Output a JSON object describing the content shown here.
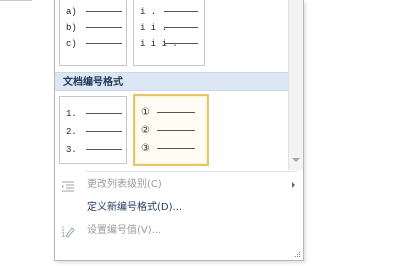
{
  "gallery": {
    "letter_tile": {
      "markers": [
        "a)",
        "b)",
        "c)"
      ]
    },
    "roman_tile": {
      "markers": [
        "i .",
        "i i .",
        "i i i ."
      ]
    },
    "section_title": "文档编号格式",
    "numeric_tile": {
      "markers": [
        "1.",
        "2.",
        "3."
      ]
    },
    "circle_tile": {
      "markers": [
        "①",
        "②",
        "③"
      ],
      "selected": true
    }
  },
  "menu": {
    "change_level": {
      "label": "更改列表级别(C)",
      "enabled": false,
      "has_submenu": true,
      "icon": "indent-level-icon"
    },
    "define_format": {
      "label": "定义新编号格式(D)...",
      "enabled": true
    },
    "set_value": {
      "label": "设置编号值(V)...",
      "enabled": false,
      "icon": "numbering-value-icon"
    }
  },
  "colors": {
    "header_bg": "#dde7f4",
    "selected_border": "#e7c46b",
    "enabled_text": "#1e395b",
    "disabled_text": "#9b9b9b"
  }
}
